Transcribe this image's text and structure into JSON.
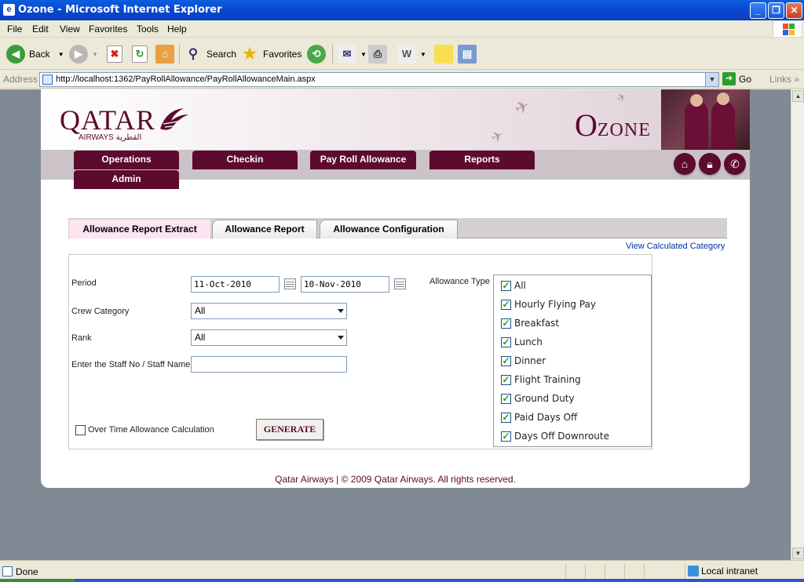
{
  "window": {
    "title": "Ozone - Microsoft Internet Explorer"
  },
  "menu": [
    "File",
    "Edit",
    "View",
    "Favorites",
    "Tools",
    "Help"
  ],
  "toolbar": {
    "back": "Back",
    "search": "Search",
    "favorites": "Favorites"
  },
  "address": {
    "label": "Address",
    "url": "http://localhost:1362/PayRollAllowance/PayRollAllowanceMain.aspx",
    "go": "Go",
    "links": "Links"
  },
  "brand": {
    "logo": "QATAR",
    "airways": "AIRWAYS القطرية",
    "ozone_first": "O",
    "ozone_rest": "ZONE"
  },
  "nav": {
    "items": [
      "Operations",
      "Checkin",
      "Pay Roll Allowance",
      "Reports",
      "Admin"
    ]
  },
  "tabs": [
    "Allowance Report Extract",
    "Allowance Report",
    "Allowance Configuration"
  ],
  "view_calc_link": "View Calculated Category",
  "form": {
    "period_label": "Period",
    "period_from": "11-Oct-2010",
    "period_to": "10-Nov-2010",
    "crew_category_label": "Crew Category",
    "crew_category_value": "All",
    "rank_label": "Rank",
    "rank_value": "All",
    "staff_label": "Enter the Staff No / Staff Name",
    "staff_value": "",
    "allowance_type_label": "Allowance Type",
    "allowance_types": [
      {
        "label": "All",
        "checked": true
      },
      {
        "label": "Hourly Flying Pay",
        "checked": true
      },
      {
        "label": "Breakfast",
        "checked": true
      },
      {
        "label": "Lunch",
        "checked": true
      },
      {
        "label": "Dinner",
        "checked": true
      },
      {
        "label": "Flight Training",
        "checked": true
      },
      {
        "label": "Ground Duty",
        "checked": true
      },
      {
        "label": "Paid Days Off",
        "checked": true
      },
      {
        "label": "Days Off Downroute",
        "checked": true
      }
    ],
    "overtime_label": "Over Time Allowance Calculation",
    "overtime_checked": false,
    "generate_label": "GENERATE"
  },
  "footer": "Qatar Airways | © 2009 Qatar Airways. All rights reserved.",
  "status": {
    "text": "Done",
    "zone": "Local intranet"
  },
  "colors": {
    "brand": "#5c0a2e",
    "link": "#003399",
    "xp_blue": "#0a4ad0"
  }
}
